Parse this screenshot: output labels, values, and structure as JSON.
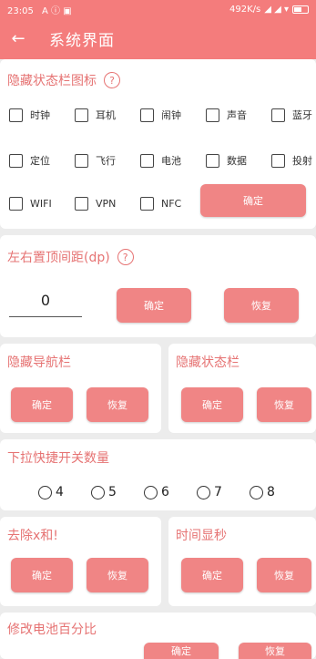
{
  "status_bar": {
    "time": "23:05",
    "left_icons": "A ⓘ ▣",
    "speed": "492K/s",
    "signal": "◢ ◢ ▾"
  },
  "app_bar": {
    "title": "系统界面"
  },
  "hide_icons": {
    "title": "隐藏状态栏图标",
    "checkboxes": [
      "时钟",
      "耳机",
      "闹钟",
      "声音",
      "蓝牙",
      "定位",
      "飞行",
      "电池",
      "数据",
      "投射",
      "WIFI",
      "VPN",
      "NFC"
    ],
    "confirm": "确定"
  },
  "top_spacing": {
    "title": "左右置顶间距(dp)",
    "value": "0",
    "confirm": "确定",
    "restore": "恢复"
  },
  "hide_nav": {
    "title": "隐藏导航栏",
    "confirm": "确定",
    "restore": "恢复"
  },
  "hide_status": {
    "title": "隐藏状态栏",
    "confirm": "确定",
    "restore": "恢复"
  },
  "quick_toggle": {
    "title": "下拉快捷开关数量",
    "options": [
      "4",
      "5",
      "6",
      "7",
      "8"
    ]
  },
  "remove_xhe": {
    "title": "去除x和!",
    "confirm": "确定",
    "restore": "恢复"
  },
  "time_seconds": {
    "title": "时间显秒",
    "confirm": "确定",
    "restore": "恢复"
  },
  "battery_percent": {
    "title": "修改电池百分比",
    "confirm": "确定",
    "restore": "恢复"
  },
  "colors": {
    "accent": "#f47c7c",
    "button": "#f08585",
    "title_text": "#e67373",
    "background": "#ececec"
  }
}
